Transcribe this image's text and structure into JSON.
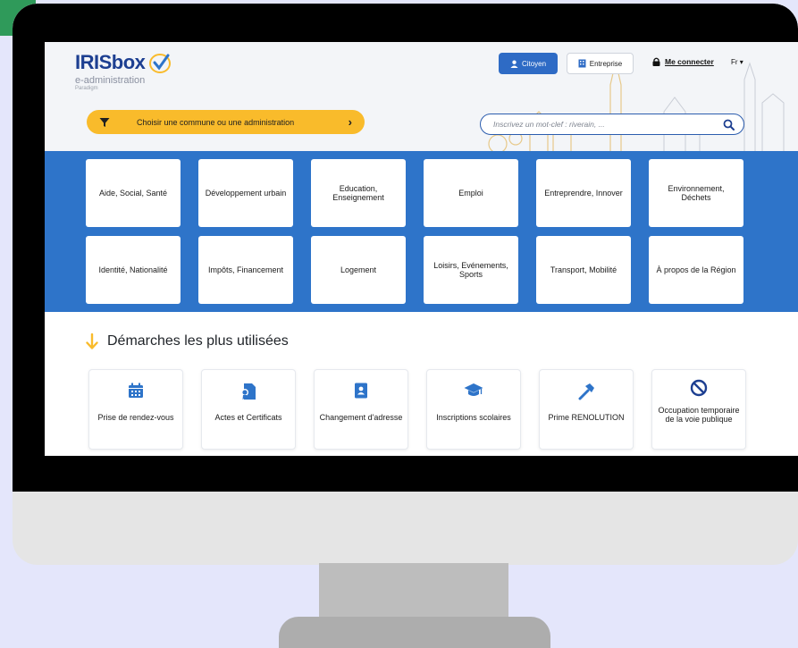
{
  "header": {
    "logo_text": "IRISbox",
    "logo_subtitle": "e-administration",
    "logo_tagline": "Paradigm",
    "btn_citoyen": "Citoyen",
    "btn_entreprise": "Entreprise",
    "login": "Me connecter",
    "lang": "Fr",
    "filter_label": "Choisir une commune ou une administration",
    "search_placeholder": "Inscrivez un mot-clef : riverain, ..."
  },
  "categories": [
    "Aide, Social, Santé",
    "Développement urbain",
    "Education, Enseignement",
    "Emploi",
    "Entreprendre, Innover",
    "Environnement, Déchets",
    "Identité, Nationalité",
    "Impôts, Financement",
    "Logement",
    "Loisirs, Evénements, Sports",
    "Transport, Mobilité",
    "À propos de la Région"
  ],
  "section": {
    "title": "Démarches les plus utilisées"
  },
  "procedures": [
    {
      "label": "Prise de rendez-vous",
      "icon": "calendar-icon"
    },
    {
      "label": "Actes et Certificats",
      "icon": "certificate-icon"
    },
    {
      "label": "Changement d'adresse",
      "icon": "address-book-icon"
    },
    {
      "label": "Inscriptions scolaires",
      "icon": "graduation-cap-icon"
    },
    {
      "label": "Prime RENOLUTION",
      "icon": "hammer-icon"
    },
    {
      "label": "Occupation temporaire de la voie publique",
      "icon": "prohibited-icon"
    }
  ],
  "colors": {
    "brand_blue": "#2e74c9",
    "yellow": "#f9bb2b",
    "logo_blue": "#1d3f91",
    "background": "#e4e6fb"
  }
}
